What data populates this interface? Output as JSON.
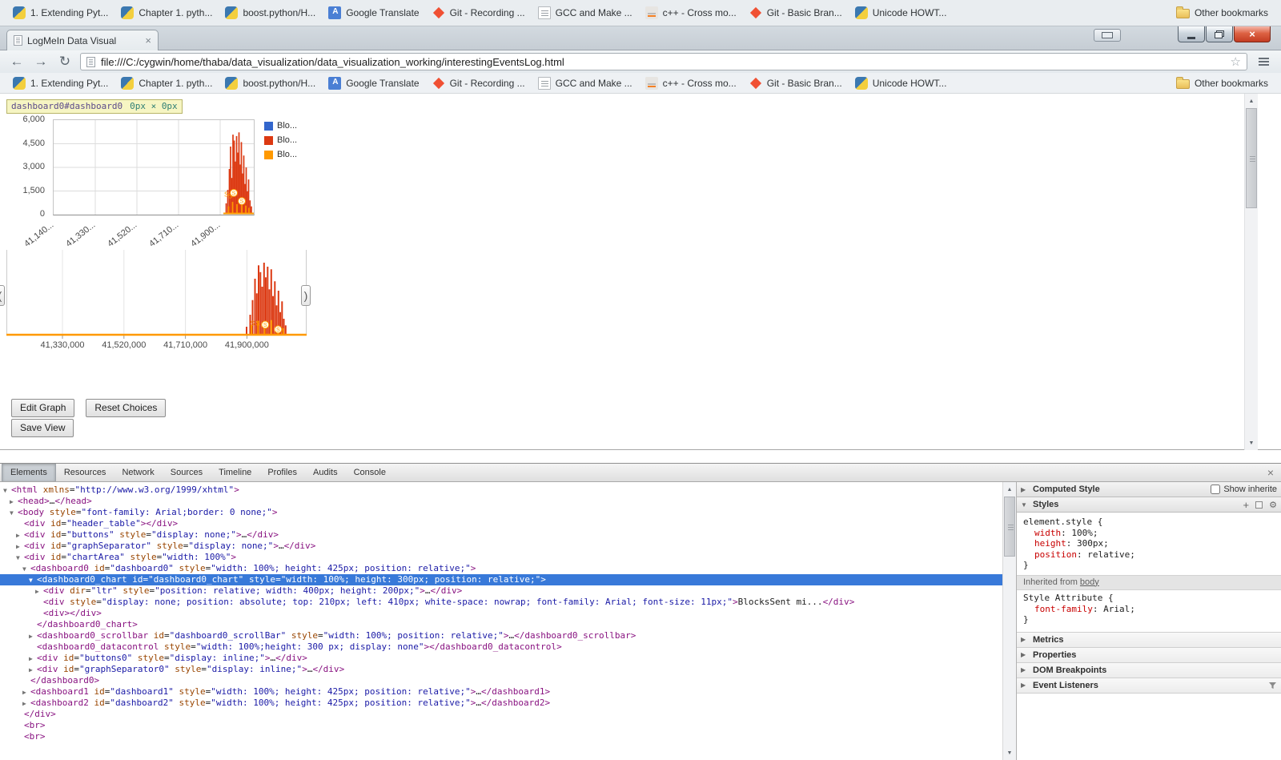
{
  "icons": {
    "back": "←",
    "forward": "→",
    "reload": "↻",
    "star": "☆",
    "tab_close": "×",
    "window_close": "×",
    "devtools_close": "×",
    "left_handle": "(",
    "right_handle": ")",
    "add_rule": "+",
    "gear": "⚙",
    "collapsed_arrow": "▶",
    "expanded_arrow": "▼",
    "scroll_up": "▲",
    "scroll_down": "▼"
  },
  "browser": {
    "tab_title": "LogMeIn Data Visual",
    "url": "file:///C:/cygwin/home/thaba/data_visualization/data_visualization_working/interestingEventsLog.html",
    "bookmarks": [
      {
        "label": "1. Extending Pyt...",
        "icon": "python"
      },
      {
        "label": "Chapter 1. pyth...",
        "icon": "python"
      },
      {
        "label": "boost.python/H...",
        "icon": "python"
      },
      {
        "label": "Google Translate",
        "icon": "translate"
      },
      {
        "label": "Git - Recording ...",
        "icon": "git"
      },
      {
        "label": "GCC and Make ...",
        "icon": "page"
      },
      {
        "label": "c++ - Cross mo...",
        "icon": "stack"
      },
      {
        "label": "Git - Basic Bran...",
        "icon": "git"
      },
      {
        "label": "Unicode HOWT...",
        "icon": "python"
      }
    ],
    "other_bookmarks_label": "Other bookmarks"
  },
  "page": {
    "inspect_tooltip": {
      "selector": "dashboard0#dashboard0",
      "size": "0px × 0px"
    },
    "buttons": {
      "edit_graph": "Edit Graph",
      "reset_choices": "Reset Choices",
      "save_view": "Save View"
    }
  },
  "chart_data": [
    {
      "type": "bar",
      "role": "main-chart",
      "title": "",
      "ylim": [
        0,
        6000
      ],
      "y_ticks": [
        "6,000",
        "4,500",
        "3,000",
        "1,500",
        "0"
      ],
      "x_ticks": [
        "41,140...",
        "41,330...",
        "41,520...",
        "41,710...",
        "41,900..."
      ],
      "grid": true,
      "legend_position": "right",
      "legend": [
        {
          "label": "Blo...",
          "color": "#3366cc"
        },
        {
          "label": "Blo...",
          "color": "#dc3912"
        },
        {
          "label": "Blo...",
          "color": "#ff9900"
        }
      ],
      "series": [
        {
          "name": "Blo... (red)",
          "color": "#dc3912",
          "points": [
            [
              0.862,
              700
            ],
            [
              0.87,
              1600
            ],
            [
              0.878,
              3000
            ],
            [
              0.884,
              4500
            ],
            [
              0.89,
              2400
            ],
            [
              0.896,
              5300
            ],
            [
              0.902,
              4900
            ],
            [
              0.908,
              3500
            ],
            [
              0.914,
              5200
            ],
            [
              0.92,
              4100
            ],
            [
              0.926,
              5450
            ],
            [
              0.932,
              3300
            ],
            [
              0.938,
              4800
            ],
            [
              0.944,
              2700
            ],
            [
              0.95,
              3900
            ],
            [
              0.956,
              2000
            ],
            [
              0.962,
              3100
            ],
            [
              0.968,
              1500
            ],
            [
              0.974,
              2300
            ],
            [
              0.981,
              900
            ],
            [
              0.988,
              500
            ]
          ]
        },
        {
          "name": "Blo... (orange)",
          "color": "#ff9900",
          "points": [
            [
              0.874,
              500
            ],
            [
              0.894,
              800
            ],
            [
              0.916,
              650
            ],
            [
              0.94,
              900
            ],
            [
              0.96,
              550
            ],
            [
              0.976,
              400
            ]
          ]
        }
      ],
      "annotations": {
        "label": "S",
        "color": "#ff9900",
        "letters": [
          [
            0.864,
            1150
          ],
          [
            0.882,
            1050
          ]
        ],
        "circles": [
          [
            0.9,
            1400
          ],
          [
            0.94,
            850
          ]
        ]
      }
    },
    {
      "type": "bar",
      "role": "range-selector",
      "ylim": [
        0,
        6000
      ],
      "x_ticks": [
        "41,330,000",
        "41,520,000",
        "41,710,000",
        "41,900,000"
      ],
      "baseline_color": "#ff9900",
      "series": [
        {
          "name": "Blo... (red)",
          "color": "#dc3912",
          "points": [
            [
              0.8,
              600
            ],
            [
              0.812,
              1500
            ],
            [
              0.82,
              2600
            ],
            [
              0.828,
              4200
            ],
            [
              0.834,
              3100
            ],
            [
              0.84,
              5200
            ],
            [
              0.846,
              4700
            ],
            [
              0.852,
              3600
            ],
            [
              0.858,
              5400
            ],
            [
              0.864,
              4300
            ],
            [
              0.87,
              5100
            ],
            [
              0.876,
              3400
            ],
            [
              0.882,
              4900
            ],
            [
              0.888,
              2900
            ],
            [
              0.894,
              4000
            ],
            [
              0.9,
              2200
            ],
            [
              0.906,
              3300
            ],
            [
              0.912,
              1700
            ],
            [
              0.918,
              2500
            ],
            [
              0.924,
              1200
            ],
            [
              0.93,
              700
            ]
          ]
        },
        {
          "name": "Blo... (orange)",
          "color": "#ff9900",
          "points": [
            [
              0.816,
              700
            ],
            [
              0.838,
              1000
            ],
            [
              0.86,
              800
            ],
            [
              0.882,
              1100
            ],
            [
              0.904,
              700
            ],
            [
              0.922,
              500
            ]
          ]
        }
      ],
      "annotations": {
        "label": "S",
        "color": "#ff9900",
        "letters": [
          [
            0.82,
            700
          ],
          [
            0.838,
            700
          ]
        ],
        "circles": [
          [
            0.862,
            750
          ],
          [
            0.905,
            400
          ]
        ]
      }
    }
  ],
  "devtools": {
    "tabs": [
      "Elements",
      "Resources",
      "Network",
      "Sources",
      "Timeline",
      "Profiles",
      "Audits",
      "Console"
    ],
    "selected_tab": "Elements",
    "tree": [
      {
        "i": 0,
        "a": "▼",
        "t": "<html xmlns=\"http://www.w3.org/1999/xhtml\">"
      },
      {
        "i": 1,
        "a": "▶",
        "t": "<head>…</head>"
      },
      {
        "i": 1,
        "a": "▼",
        "t": "<body style=\"font-family: Arial;border: 0 none;\">"
      },
      {
        "i": 2,
        "a": "",
        "t": "<div id=\"header_table\"></div>"
      },
      {
        "i": 2,
        "a": "▶",
        "t": "<div id=\"buttons\" style=\"display: none;\">…</div>"
      },
      {
        "i": 2,
        "a": "▶",
        "t": "<div id=\"graphSeparator\" style=\"display: none;\">…</div>"
      },
      {
        "i": 2,
        "a": "▼",
        "t": "<div id=\"chartArea\" style=\"width: 100%\">"
      },
      {
        "i": 3,
        "a": "▼",
        "t": "<dashboard0 id=\"dashboard0\" style=\"width: 100%; height: 425px; position: relative;\">"
      },
      {
        "i": 4,
        "a": "▼",
        "t": "<dashboard0_chart id=\"dashboard0_chart\" style=\"width: 100%; height: 300px; position: relative;\">",
        "sel": true
      },
      {
        "i": 5,
        "a": "▶",
        "t": "<div dir=\"ltr\" style=\"position: relative; width: 400px; height: 200px;\">…</div>"
      },
      {
        "i": 5,
        "a": "",
        "t": "<div style=\"display: none; position: absolute; top: 210px; left: 410px; white-space: nowrap; font-family: Arial; font-size: 11px;\">BlocksSent mi...</div>"
      },
      {
        "i": 5,
        "a": "",
        "t": "<div></div>"
      },
      {
        "i": 4,
        "a": "",
        "t": "</dashboard0_chart>"
      },
      {
        "i": 4,
        "a": "▶",
        "t": "<dashboard0_scrollbar id=\"dashboard0_scrollBar\" style=\"width: 100%; position: relative;\">…</dashboard0_scrollbar>"
      },
      {
        "i": 4,
        "a": "",
        "t": "<dashboard0_datacontrol style=\"width: 100%;height: 300 px; display: none\"></dashboard0_datacontrol>"
      },
      {
        "i": 4,
        "a": "▶",
        "t": "<div id=\"buttons0\" style=\"display: inline;\">…</div>"
      },
      {
        "i": 4,
        "a": "▶",
        "t": "<div id=\"graphSeparator0\" style=\"display: inline;\">…</div>"
      },
      {
        "i": 3,
        "a": "",
        "t": "</dashboard0>"
      },
      {
        "i": 3,
        "a": "▶",
        "t": "<dashboard1 id=\"dashboard1\" style=\"width: 100%; height: 425px; position: relative;\">…</dashboard1>"
      },
      {
        "i": 3,
        "a": "▶",
        "t": "<dashboard2 id=\"dashboard2\" style=\"width: 100%; height: 425px; position: relative;\">…</dashboard2>"
      },
      {
        "i": 2,
        "a": "",
        "t": "</div>"
      },
      {
        "i": 2,
        "a": "",
        "t": "<br>"
      },
      {
        "i": 2,
        "a": "",
        "t": "<br>"
      }
    ],
    "sidebar": {
      "computed_style_label": "Computed Style",
      "show_inherited_label": "Show inherite",
      "styles_label": "Styles",
      "rules": [
        {
          "type": "rule",
          "selector": "element.style",
          "props": [
            {
              "name": "width",
              "value": "100%"
            },
            {
              "name": "height",
              "value": "300px"
            },
            {
              "name": "position",
              "value": "relative"
            }
          ]
        },
        {
          "type": "inherited",
          "label": "Inherited from",
          "link": "body"
        },
        {
          "type": "rule",
          "selector": "Style Attribute",
          "props": [
            {
              "name": "font-family",
              "value": "Arial"
            }
          ]
        }
      ],
      "sections": [
        "Metrics",
        "Properties",
        "DOM Breakpoints",
        "Event Listeners"
      ]
    }
  }
}
